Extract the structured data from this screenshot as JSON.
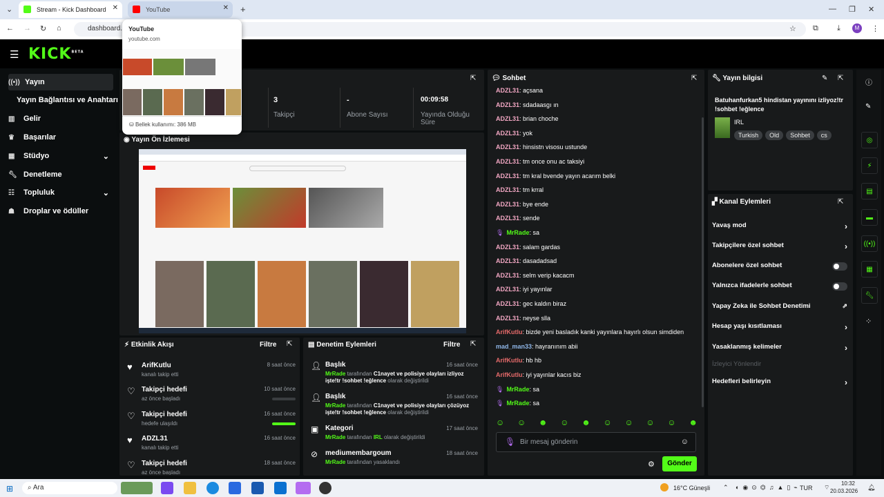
{
  "browser": {
    "tabs": [
      {
        "label": "Stream - Kick Dashboard",
        "active": true
      },
      {
        "label": "YouTube",
        "active": false
      }
    ],
    "url": "dashboard.k",
    "hovercard": {
      "title": "YouTube",
      "domain": "youtube.com",
      "memory": "Bellek kullanımı: 386 MB"
    }
  },
  "brand": {
    "logo": "KICK",
    "beta": "BETA",
    "accent": "#53fc18"
  },
  "sidebar": {
    "items": [
      {
        "label": "Yayın",
        "icon": "broadcast-icon"
      },
      {
        "label": "Yayın Bağlantısı ve Anahtarı",
        "icon": ""
      },
      {
        "label": "Gelir",
        "icon": "chart-icon"
      },
      {
        "label": "Başarılar",
        "icon": "trophy-icon"
      },
      {
        "label": "Stüdyo",
        "icon": "studio-icon"
      },
      {
        "label": "Denetleme",
        "icon": "wrench-icon"
      },
      {
        "label": "Topluluk",
        "icon": "community-icon"
      },
      {
        "label": "Droplar ve ödüller",
        "icon": "gift-icon"
      }
    ]
  },
  "stats": [
    {
      "value": "3",
      "label": "Takipçi"
    },
    {
      "value": "-",
      "label": "Abone Sayısı"
    },
    {
      "value": "00:09:58",
      "label": "Yayında Olduğu Süre"
    }
  ],
  "preview": {
    "title": "Yayın Ön İzlemesi"
  },
  "activity": {
    "title": "Etkinlik Akışı",
    "filter": "Filtre",
    "items": [
      {
        "title": "ArifKutlu",
        "sub": "kanalı takip etti",
        "time": "8 saat önce",
        "progress": 0
      },
      {
        "title": "Takipçi hedefi",
        "sub": "az önce başladı",
        "time": "10 saat önce",
        "progress": 0
      },
      {
        "title": "Takipçi hedefi",
        "sub": "hedefe ulaşıldı",
        "time": "16 saat önce",
        "progress": 1
      },
      {
        "title": "ADZL31",
        "sub": "kanalı takip etti",
        "time": "16 saat önce",
        "progress": 0
      },
      {
        "title": "Takipçi hedefi",
        "sub": "az önce başladı",
        "time": "18 saat önce",
        "progress": 0
      }
    ]
  },
  "moderation": {
    "title": "Denetim Eylemleri",
    "filter": "Filtre",
    "items": [
      {
        "title": "Başlık",
        "user": "MrRade",
        "mid": " tarafından ",
        "value": "C1nayet ve polisiye olayları izliyoz işte!tr !sohbet !eğlence",
        "tail": " olarak değiştirildi",
        "time": "16 saat önce"
      },
      {
        "title": "Başlık",
        "user": "MrRade",
        "mid": " tarafından ",
        "value": "C1nayet ve polisiye olayları çözüyoz işte!tr !sohbet !eğlence",
        "tail": " olarak değiştirildi",
        "time": "16 saat önce"
      },
      {
        "title": "Kategori",
        "user": "MrRade",
        "mid": " tarafından ",
        "value": "IRL",
        "tail": " olarak değiştirildi",
        "time": "17 saat önce"
      },
      {
        "title": "mediumembargoum",
        "user": "MrRade",
        "mid": " tarafından yasaklandı",
        "value": "",
        "tail": "",
        "time": "18 saat önce"
      }
    ]
  },
  "chat": {
    "title": "Sohbet",
    "messages": [
      {
        "user": "ADZL31",
        "text": "açsana",
        "color": "#f2a7c3"
      },
      {
        "user": "ADZL31",
        "text": "sdadaasgı ın",
        "color": "#f2a7c3"
      },
      {
        "user": "ADZL31",
        "text": "brian choche",
        "color": "#f2a7c3"
      },
      {
        "user": "ADZL31",
        "text": "yok",
        "color": "#f2a7c3"
      },
      {
        "user": "ADZL31",
        "text": "hinsistn visosu ustunde",
        "color": "#f2a7c3"
      },
      {
        "user": "ADZL31",
        "text": "tm once onu ac taksiyi",
        "color": "#f2a7c3"
      },
      {
        "user": "ADZL31",
        "text": "tm kral bvende yayın acarım belki",
        "color": "#f2a7c3"
      },
      {
        "user": "ADZL31",
        "text": "tm krral",
        "color": "#f2a7c3"
      },
      {
        "user": "ADZL31",
        "text": "bye ende",
        "color": "#f2a7c3"
      },
      {
        "user": "ADZL31",
        "text": "sende",
        "color": "#f2a7c3"
      },
      {
        "user": "MrRade",
        "text": "sa",
        "color": "#53fc18",
        "badge": true
      },
      {
        "user": "ADZL31",
        "text": "salam gardas",
        "color": "#f2a7c3"
      },
      {
        "user": "ADZL31",
        "text": "dasadadsad",
        "color": "#f2a7c3"
      },
      {
        "user": "ADZL31",
        "text": "selm verip kacacm",
        "color": "#f2a7c3"
      },
      {
        "user": "ADZL31",
        "text": "iyi yayınlar",
        "color": "#f2a7c3"
      },
      {
        "user": "ADZL31",
        "text": "gec kaldın biraz",
        "color": "#f2a7c3"
      },
      {
        "user": "ADZL31",
        "text": "neyse slla",
        "color": "#f2a7c3"
      },
      {
        "user": "ArifKutlu",
        "text": "bizde yeni basladık kanki yayınlara hayırlı olsun simdiden",
        "color": "#e56a6a"
      },
      {
        "user": "mad_man33",
        "text": "hayranınım abii",
        "color": "#8fb6e8"
      },
      {
        "user": "ArifKutlu",
        "text": "hb hb",
        "color": "#e56a6a"
      },
      {
        "user": "ArifKutlu",
        "text": "iyi yayınlar kacıs biz",
        "color": "#e56a6a"
      },
      {
        "user": "MrRade",
        "text": "sa",
        "color": "#53fc18",
        "badge": true
      },
      {
        "user": "MrRade",
        "text": "sa",
        "color": "#53fc18",
        "badge": true
      }
    ],
    "placeholder": "Bir mesaj gönderin",
    "send": "Gönder"
  },
  "streaminfo": {
    "title": "Yayın bilgisi",
    "stream_title": "Batuhanfurkan5 hindistan yayınını izliyoz!tr !sohbet !eğlence",
    "category": "IRL",
    "tags": [
      "Turkish",
      "Old",
      "Sohbet",
      "cs"
    ]
  },
  "channel_actions": {
    "title": "Kanal Eylemleri",
    "items": [
      {
        "label": "Yavaş mod",
        "kind": "chevron"
      },
      {
        "label": "Takipçilere özel sohbet",
        "kind": "chevron"
      },
      {
        "label": "Abonelere özel sohbet",
        "kind": "toggle"
      },
      {
        "label": "Yalnızca ifadelerle sohbet",
        "kind": "toggle"
      },
      {
        "label": "Yapay Zeka ile Sohbet Denetimi",
        "kind": "external"
      },
      {
        "label": "Hesap yaşı kısıtlaması",
        "kind": "chevron"
      },
      {
        "label": "Yasaklanmış kelimeler",
        "kind": "chevron"
      },
      {
        "label": "İzleyici Yönlendir",
        "kind": "disabled"
      },
      {
        "label": "Hedefleri belirleyin",
        "kind": "chevron"
      }
    ]
  },
  "taskbar": {
    "search": "Ara",
    "weather": "16°C  Güneşli",
    "lang": "TUR",
    "time": "10:32",
    "date": "20.03.2026"
  }
}
